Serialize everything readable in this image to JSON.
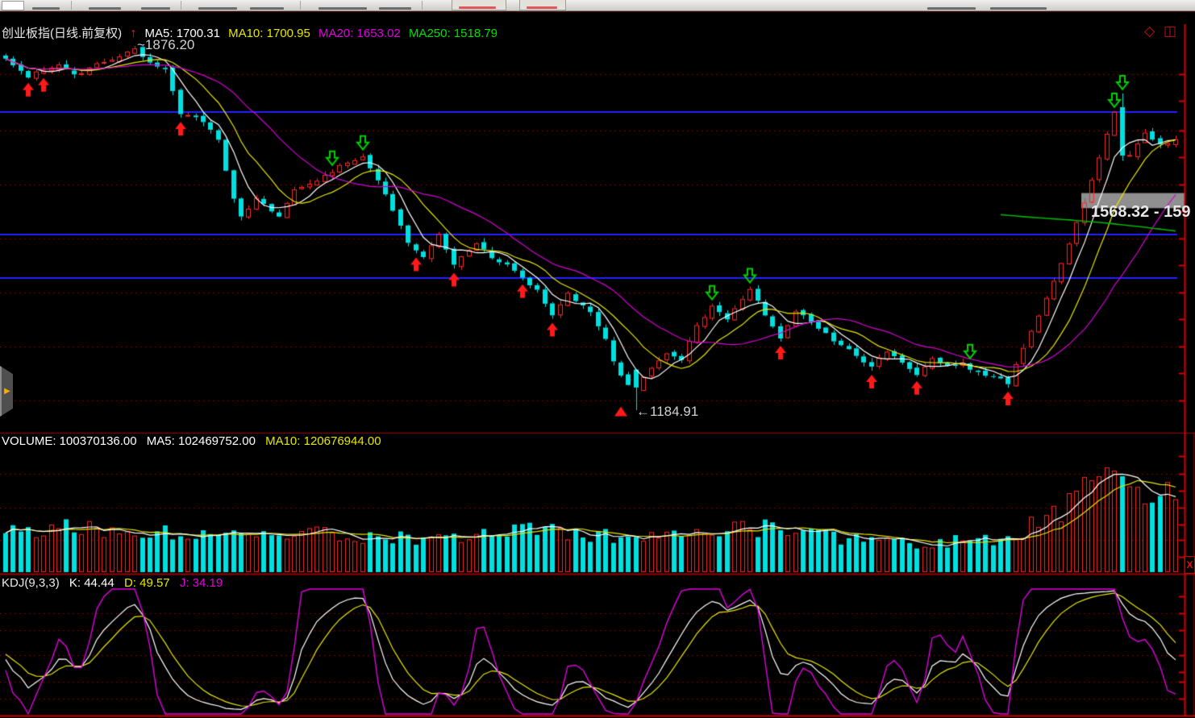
{
  "ui": {
    "title_row": {
      "symbol": "创业板指(日线.前复权)",
      "ma5": "MA5: 1700.31",
      "ma10": "MA10: 1700.95",
      "ma20": "MA20: 1653.02",
      "ma250": "MA250: 1518.79"
    },
    "volume_row": {
      "volume": "VOLUME: 100370136.00",
      "ma5": "MA5: 102469752.00",
      "ma10": "MA10: 120676944.00"
    },
    "kdj_row": {
      "label": "KDJ(9,3,3)",
      "k": "K: 44.44",
      "d": "D: 49.57",
      "j": "J: 34.19"
    },
    "annotations": {
      "high": "~1876.20",
      "low": "←1184.91",
      "range": "1568.32 - 159"
    },
    "icons": {
      "up_arrow": "↑",
      "diamond": "◇",
      "split": "◫",
      "flyout": "▶",
      "close": "X"
    }
  },
  "colors": {
    "background": "#000000",
    "candle_up": "#ff2626",
    "candle_down": "#00e0e0",
    "ma5": "#ffffff",
    "ma10": "#e6e600",
    "ma20": "#d400d4",
    "ma250": "#00b300",
    "grid_dotted": "#a00000",
    "pane_border": "#9b0000",
    "scale_line": "#d40000",
    "blue_level": "#2222ff",
    "buy_marker": "#ff1a1a",
    "sell_marker": "#00cf00",
    "band_fill": "#8f8f8f"
  },
  "chart_data": [
    {
      "type": "candlestick",
      "title": "创业板指(日线.前复权)",
      "bars": 155,
      "overlays": [
        {
          "name": "MA5",
          "color": "#ffffff",
          "last": 1700.31
        },
        {
          "name": "MA10",
          "color": "#e6e600",
          "last": 1700.95
        },
        {
          "name": "MA20",
          "color": "#d400d4",
          "last": 1653.02
        },
        {
          "name": "MA250",
          "color": "#00b300",
          "last": 1518.79
        }
      ],
      "labeled_points": {
        "high": 1876.2,
        "low": 1184.91
      },
      "price_anchors": [
        [
          0,
          1853
        ],
        [
          2,
          1826
        ],
        [
          3,
          1818
        ],
        [
          5,
          1832
        ],
        [
          7,
          1841
        ],
        [
          9,
          1822
        ],
        [
          11,
          1833
        ],
        [
          13,
          1848
        ],
        [
          15,
          1856
        ],
        [
          17,
          1871
        ],
        [
          19,
          1845
        ],
        [
          21,
          1833
        ],
        [
          23,
          1749
        ],
        [
          26,
          1734
        ],
        [
          28,
          1696
        ],
        [
          30,
          1585
        ],
        [
          31,
          1550
        ],
        [
          33,
          1588
        ],
        [
          36,
          1550
        ],
        [
          38,
          1604
        ],
        [
          41,
          1619
        ],
        [
          44,
          1650
        ],
        [
          47,
          1665
        ],
        [
          49,
          1620
        ],
        [
          50,
          1596
        ],
        [
          53,
          1504
        ],
        [
          55,
          1474
        ],
        [
          57,
          1519
        ],
        [
          59,
          1459
        ],
        [
          62,
          1504
        ],
        [
          64,
          1474
        ],
        [
          66,
          1460
        ],
        [
          68,
          1436
        ],
        [
          70,
          1413
        ],
        [
          72,
          1367
        ],
        [
          74,
          1405
        ],
        [
          77,
          1374
        ],
        [
          79,
          1320
        ],
        [
          80,
          1275
        ],
        [
          82,
          1230
        ],
        [
          83,
          1228
        ],
        [
          85,
          1267
        ],
        [
          87,
          1290
        ],
        [
          89,
          1283
        ],
        [
          91,
          1344
        ],
        [
          93,
          1382
        ],
        [
          95,
          1359
        ],
        [
          98,
          1413
        ],
        [
          100,
          1367
        ],
        [
          102,
          1321
        ],
        [
          104,
          1374
        ],
        [
          106,
          1352
        ],
        [
          108,
          1329
        ],
        [
          110,
          1306
        ],
        [
          112,
          1290
        ],
        [
          114,
          1267
        ],
        [
          116,
          1298
        ],
        [
          118,
          1275
        ],
        [
          120,
          1252
        ],
        [
          122,
          1283
        ],
        [
          124,
          1267
        ],
        [
          126,
          1275
        ],
        [
          127,
          1260
        ],
        [
          129,
          1252
        ],
        [
          131,
          1244
        ],
        [
          132,
          1237
        ],
        [
          134,
          1306
        ],
        [
          136,
          1367
        ],
        [
          138,
          1428
        ],
        [
          140,
          1504
        ],
        [
          142,
          1581
        ],
        [
          144,
          1665
        ],
        [
          146,
          1749
        ],
        [
          147,
          1668
        ],
        [
          148,
          1672
        ],
        [
          150,
          1710
        ],
        [
          152,
          1687
        ],
        [
          154,
          1702
        ]
      ],
      "forced_bars": {
        "17": {
          "high": 1876.2
        },
        "83": {
          "open": 1262,
          "close": 1228,
          "low": 1184.91
        },
        "147": {
          "open": 1760,
          "close": 1668,
          "high": 1786,
          "low": 1658
        }
      },
      "support_lines_blue": [
        1751,
        1518,
        1436
      ],
      "grid_levels_dotted": [
        1823,
        1716,
        1613,
        1511,
        1408,
        1306,
        1203
      ],
      "ma250_anchors": [
        [
          131,
          1556
        ],
        [
          135,
          1551
        ],
        [
          140,
          1546
        ],
        [
          145,
          1540
        ],
        [
          150,
          1532
        ],
        [
          154,
          1525
        ]
      ],
      "markers": {
        "buy_bars": [
          3,
          5,
          23,
          54,
          59,
          68,
          72,
          102,
          114,
          120,
          132
        ],
        "sell_bars": [
          43,
          47,
          93,
          98,
          127,
          146,
          147
        ],
        "low_triangle": {
          "bar": 81,
          "price": 1192
        }
      },
      "range_band": {
        "from_price": 1568.32,
        "to_price": 1597.0,
        "start_bar": 142,
        "label": "1568.32 - 159"
      }
    },
    {
      "type": "bar",
      "title": "VOLUME",
      "last_values": {
        "volume": 100370136.0,
        "ma5": 102469752.0,
        "ma10": 120676944.0
      },
      "envelope_anchors": [
        [
          0,
          52
        ],
        [
          10,
          56
        ],
        [
          20,
          52
        ],
        [
          30,
          50
        ],
        [
          40,
          50
        ],
        [
          48,
          44
        ],
        [
          55,
          40
        ],
        [
          62,
          46
        ],
        [
          70,
          52
        ],
        [
          78,
          46
        ],
        [
          85,
          42
        ],
        [
          90,
          50
        ],
        [
          95,
          58
        ],
        [
          100,
          55
        ],
        [
          105,
          48
        ],
        [
          110,
          42
        ],
        [
          115,
          38
        ],
        [
          120,
          36
        ],
        [
          125,
          38
        ],
        [
          130,
          40
        ],
        [
          134,
          52
        ],
        [
          137,
          68
        ],
        [
          139,
          80
        ],
        [
          141,
          95
        ],
        [
          143,
          108
        ],
        [
          145,
          118
        ],
        [
          146,
          128
        ],
        [
          147,
          140
        ],
        [
          148,
          122
        ],
        [
          149,
          100
        ],
        [
          150,
          88
        ],
        [
          151,
          82
        ],
        [
          152,
          78
        ],
        [
          153,
          92
        ],
        [
          154,
          88
        ]
      ]
    },
    {
      "type": "line",
      "title": "KDJ(9,3,3)",
      "series": [
        {
          "name": "K",
          "color": "#ffffff",
          "last": 44.44
        },
        {
          "name": "D",
          "color": "#e6e600",
          "last": 49.57
        },
        {
          "name": "J",
          "color": "#d400d4",
          "last": 34.19
        }
      ],
      "y_range": [
        0,
        100
      ]
    }
  ]
}
